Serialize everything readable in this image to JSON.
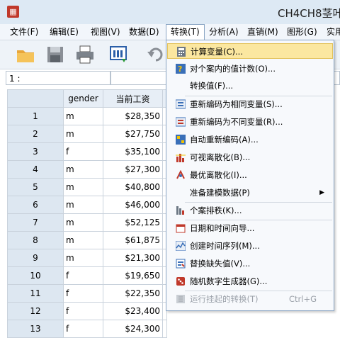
{
  "window": {
    "title": "CH4CH8茎叶"
  },
  "menu": [
    {
      "label": "文件(F)"
    },
    {
      "label": "编辑(E)"
    },
    {
      "label": "视图(V)"
    },
    {
      "label": "数据(D)"
    },
    {
      "label": "转换(T)"
    },
    {
      "label": "分析(A)"
    },
    {
      "label": "直销(M)"
    },
    {
      "label": "图形(G)"
    },
    {
      "label": "实用"
    }
  ],
  "cell_ref": "1 :",
  "columns": [
    "gender",
    "当前工资"
  ],
  "rows": [
    {
      "n": "1",
      "g": "m",
      "s": "$28,350"
    },
    {
      "n": "2",
      "g": "m",
      "s": "$27,750"
    },
    {
      "n": "3",
      "g": "f",
      "s": "$35,100"
    },
    {
      "n": "4",
      "g": "m",
      "s": "$27,300"
    },
    {
      "n": "5",
      "g": "m",
      "s": "$40,800"
    },
    {
      "n": "6",
      "g": "m",
      "s": "$46,000"
    },
    {
      "n": "7",
      "g": "m",
      "s": "$52,125"
    },
    {
      "n": "8",
      "g": "m",
      "s": "$61,875"
    },
    {
      "n": "9",
      "g": "m",
      "s": "$21,300"
    },
    {
      "n": "10",
      "g": "f",
      "s": "$19,650"
    },
    {
      "n": "11",
      "g": "f",
      "s": "$22,350"
    },
    {
      "n": "12",
      "g": "f",
      "s": "$23,400"
    },
    {
      "n": "13",
      "g": "f",
      "s": "$24,300"
    }
  ],
  "dropdown": {
    "compute": "计算变量(C)...",
    "count": "对个案内的值计数(O)...",
    "shift": "转换值(F)...",
    "recode_same": "重新编码为相同变量(S)...",
    "recode_diff": "重新编码为不同变量(R)...",
    "auto_recode": "自动重新编码(A)...",
    "visual_binning": "可视离散化(B)...",
    "optimal_binning": "最优离散化(I)...",
    "prepare_modeling": "准备建模数据(P)",
    "rank_cases": "个案排秩(K)...",
    "date_wizard": "日期和时间向导...",
    "time_series": "创建时间序列(M)...",
    "replace_missing": "替换缺失值(V)...",
    "rng": "随机数字生成器(G)...",
    "run_pending": "运行挂起的转换(T)",
    "run_pending_shortcut": "Ctrl+G"
  }
}
